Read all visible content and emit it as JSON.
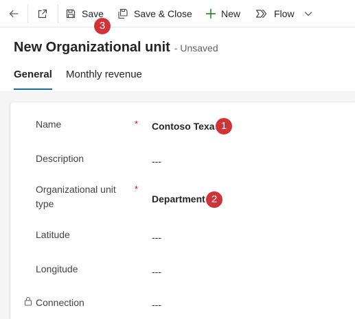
{
  "toolbar": {
    "save_label": "Save",
    "save_close_label": "Save & Close",
    "new_label": "New",
    "flow_label": "Flow"
  },
  "header": {
    "title": "New Organizational unit",
    "status": "- Unsaved"
  },
  "tabs": [
    {
      "label": "General",
      "active": true
    },
    {
      "label": "Monthly revenue",
      "active": false
    }
  ],
  "form": {
    "name": {
      "label": "Name",
      "value": "Contoso Texas",
      "required_mark": "*"
    },
    "description": {
      "label": "Description",
      "value": "---"
    },
    "org_unit_type": {
      "label_line1": "Organizational unit",
      "label_line2": "type",
      "value": "Department",
      "required_mark": "*"
    },
    "latitude": {
      "label": "Latitude",
      "value": "---"
    },
    "longitude": {
      "label": "Longitude",
      "value": "---"
    },
    "connection": {
      "label": "Connection",
      "value": "---"
    }
  },
  "callouts": {
    "one": "1",
    "two": "2",
    "three": "3"
  },
  "colors": {
    "accent": "#0f6cbd",
    "new_plus": "#107c10",
    "required": "#c50f1f",
    "callout": "#d13438"
  },
  "icons": [
    "back-arrow-icon",
    "popout-icon",
    "save-icon",
    "save-close-icon",
    "plus-icon",
    "flow-icon",
    "chevron-down-icon",
    "lock-icon"
  ]
}
